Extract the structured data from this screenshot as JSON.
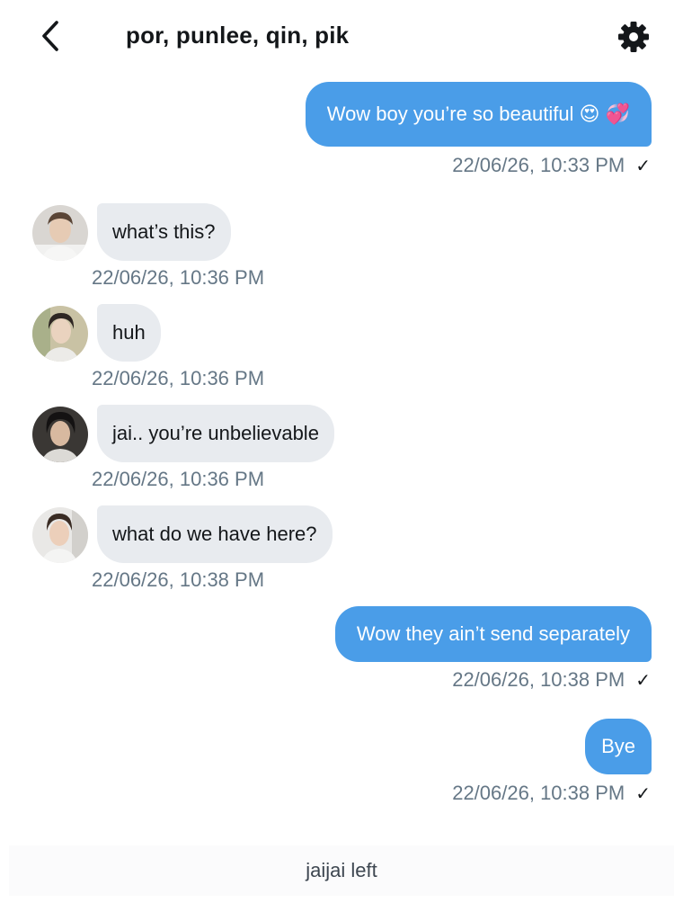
{
  "header": {
    "title": "por, punlee, qin, pik",
    "back_icon": "chevron-left-icon",
    "settings_icon": "gear-icon"
  },
  "colors": {
    "outgoing_bubble": "#4a9de8",
    "incoming_bubble": "#e8ebef",
    "timestamp": "#657786"
  },
  "messages": [
    {
      "direction": "outgoing",
      "text": "Wow boy you’re so beautiful 😍 💞",
      "timestamp": "22/06/26, 10:33 PM",
      "read_mark": "✓"
    },
    {
      "direction": "incoming",
      "text": "what’s this?",
      "timestamp": "22/06/26, 10:36 PM",
      "avatar": "avatar-1"
    },
    {
      "direction": "incoming",
      "text": "huh",
      "timestamp": "22/06/26, 10:36 PM",
      "avatar": "avatar-2"
    },
    {
      "direction": "incoming",
      "text": "jai.. you’re unbelievable",
      "timestamp": "22/06/26, 10:36 PM",
      "avatar": "avatar-3"
    },
    {
      "direction": "incoming",
      "text": "what do we have here?",
      "timestamp": "22/06/26, 10:38 PM",
      "avatar": "avatar-4"
    },
    {
      "direction": "outgoing",
      "text": "Wow they ain’t send separately",
      "timestamp": "22/06/26, 10:38 PM",
      "read_mark": "✓"
    },
    {
      "direction": "outgoing",
      "text": "Bye",
      "timestamp": "22/06/26, 10:38 PM",
      "read_mark": "✓"
    }
  ],
  "system_message": "jaijai left"
}
